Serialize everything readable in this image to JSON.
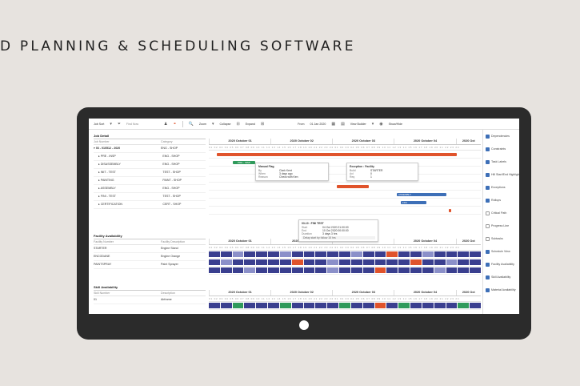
{
  "hero_title": "D PLANNING & SCHEDULING SOFTWARE",
  "colors": {
    "accent": "#e0532b",
    "blue": "#3d6fb7",
    "green": "#2f9a5b",
    "navy": "#3a3f8f",
    "bezel": "#2b2b2b",
    "background": "#e7e3df"
  },
  "toolbar": {
    "job_sort": "Job Sort",
    "find_label": "Find Now",
    "zoom": "Zoom",
    "collapse": "Collapse",
    "expand": "Expand",
    "from": "From",
    "from_date": "01 Jan 2020",
    "view_builder": "View Builder",
    "show_hide": "Show/Hide"
  },
  "job_detail": {
    "title": "Job Detail",
    "headers": [
      "Job Number",
      "Category"
    ],
    "rows": [
      {
        "name": "03 - 010512 - 2020",
        "cat": "ENG - SHOP"
      },
      {
        "name": "PRE - INSP",
        "cat": "ENG - SHOP"
      },
      {
        "name": "DISASSEMBLY",
        "cat": "ENG - SHOP"
      },
      {
        "name": "INIT - TEST",
        "cat": "TEST - SHOP"
      },
      {
        "name": "PAINTING",
        "cat": "PAINT - SHOP"
      },
      {
        "name": "ASSEMBLY",
        "cat": "ENG - SHOP"
      },
      {
        "name": "FINI - TEST",
        "cat": "TEST - SHOP"
      },
      {
        "name": "CERTIFICATION",
        "cat": "CERT - SHOP"
      }
    ],
    "dates": [
      "2020 October 01",
      "2020 October 02",
      "2020 October 03",
      "2020 October 04",
      "2020 Oct"
    ]
  },
  "facility": {
    "title": "Facility Availability",
    "headers": [
      "Facility Number",
      "Facility Description"
    ],
    "rows": [
      {
        "name": "STARTER",
        "desc": "Engine Stand"
      },
      {
        "name": "ENCODANE",
        "desc": "Engine Orange"
      },
      {
        "name": "PAINTSPRAY",
        "desc": "Paint Sprayer"
      }
    ],
    "dates": [
      "2020 October 01",
      "2020 October",
      "",
      "2020 October 04",
      "2020 Oct"
    ]
  },
  "skill": {
    "title": "Skill Availability",
    "headers": [
      "Skill Number",
      "Description"
    ],
    "rows": [
      {
        "name": "01",
        "desc": "Airframe"
      }
    ],
    "dates": [
      "2020 October 01",
      "2020 October 02",
      "2020 October 03",
      "2020 October 04",
      "2020 Oct"
    ]
  },
  "ticks": "01 02 03 04 05 06 07 08 09 10 11 12 13 14 15 16 17 18 19 20 21 22 23 24 01 02 03 04 05 06 07 08 09 10 11 12 13 14 15 16 17 18 19 20 21 22 23 24",
  "popups": {
    "manual_flag": {
      "title": "Manual Flag",
      "rows": [
        [
          "By",
          "Clark Kent"
        ],
        [
          "When",
          "3 days ago"
        ],
        [
          "Reason",
          "Check with Ken"
        ]
      ]
    },
    "exception": {
      "title": "Exception : Facility",
      "rows": [
        [
          "Build",
          "STARTER"
        ],
        [
          "Avl",
          "0"
        ],
        [
          "Req",
          "1"
        ]
      ]
    },
    "fini_test": {
      "title": "03-10 : FINI TEST",
      "rows": [
        [
          "Start",
          "04 Oct 2020 21:00:00"
        ],
        [
          "End",
          "10 Oct 2020 00:00:00"
        ],
        [
          "Duration",
          "3 days 3 hrs"
        ]
      ]
    },
    "ribbon": "Delay start by follow 15 hrs"
  },
  "bar_labels": {
    "pre_insp": "PRE - INSP",
    "assembly": "ASSEMBLY",
    "fini": "FINI"
  },
  "right_panel": [
    {
      "label": "Dependencies",
      "on": true
    },
    {
      "label": "Constraints",
      "on": true
    },
    {
      "label": "Task Labels",
      "on": true
    },
    {
      "label": "Hill Start/End Highlights",
      "on": true
    },
    {
      "label": "Exceptions",
      "on": true
    },
    {
      "label": "Rollups",
      "on": true
    },
    {
      "label": "Critical Path",
      "on": false
    },
    {
      "label": "Progress Line",
      "on": false
    },
    {
      "label": "Subtasks",
      "on": false
    },
    {
      "label": "Schedule View",
      "on": true
    },
    {
      "label": "Facility Availability",
      "on": true
    },
    {
      "label": "Skill Availability",
      "on": true
    },
    {
      "label": "Material Availability",
      "on": true
    }
  ]
}
